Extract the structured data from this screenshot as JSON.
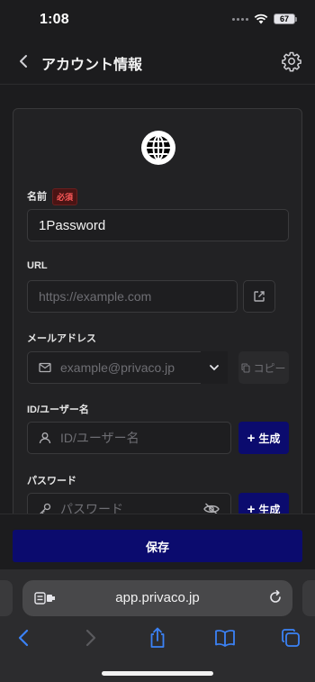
{
  "status_bar": {
    "time": "1:08",
    "battery": "67"
  },
  "header": {
    "title": "アカウント情報"
  },
  "form": {
    "name": {
      "label": "名前",
      "required_badge": "必須",
      "value": "1Password"
    },
    "url": {
      "label": "URL",
      "placeholder": "https://example.com"
    },
    "email": {
      "label": "メールアドレス",
      "placeholder": "example@privaco.jp",
      "copy_label": "コピー"
    },
    "user_id": {
      "label": "ID/ユーザー名",
      "placeholder": "ID/ユーザー名",
      "generate_label": "生成"
    },
    "password": {
      "label": "パスワード",
      "placeholder": "パスワード",
      "generate_label": "生成"
    }
  },
  "save_button": "保存",
  "browser": {
    "url": "app.privaco.jp"
  },
  "colors": {
    "accent": "#0b0b6e",
    "required": "#ff5a5a",
    "background": "#1c1c1e"
  }
}
